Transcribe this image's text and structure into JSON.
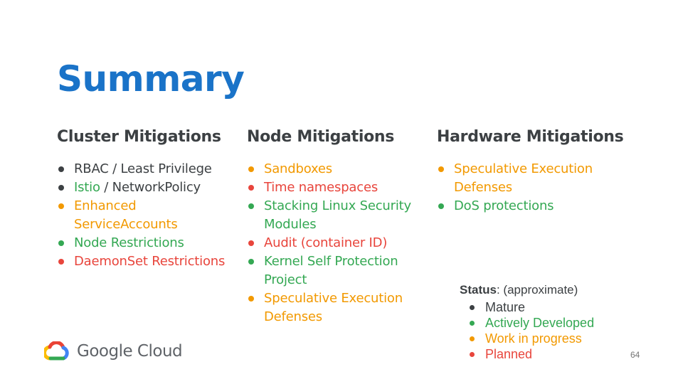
{
  "title": "Summary",
  "colors": {
    "title": "#1a73c8",
    "mature": "#3c4043",
    "active": "#34a853",
    "wip": "#f29900",
    "planned": "#e8453c"
  },
  "columns": [
    {
      "heading": "Cluster Mitigations",
      "items": [
        {
          "segments": [
            {
              "text": "RBAC / Least Privilege",
              "status": "mature"
            }
          ],
          "bullet": "mature"
        },
        {
          "segments": [
            {
              "text": "Istio",
              "status": "active"
            },
            {
              "text": " / NetworkPolicy",
              "status": "mature"
            }
          ],
          "bullet": "mature"
        },
        {
          "segments": [
            {
              "text": "Enhanced ServiceAccounts",
              "status": "wip"
            }
          ],
          "bullet": "wip"
        },
        {
          "segments": [
            {
              "text": "Node Restrictions",
              "status": "active"
            }
          ],
          "bullet": "active"
        },
        {
          "segments": [
            {
              "text": "DaemonSet Restrictions",
              "status": "planned"
            }
          ],
          "bullet": "planned"
        }
      ]
    },
    {
      "heading": "Node Mitigations",
      "items": [
        {
          "segments": [
            {
              "text": "Sandboxes",
              "status": "wip"
            }
          ],
          "bullet": "wip"
        },
        {
          "segments": [
            {
              "text": "Time namespaces",
              "status": "planned"
            }
          ],
          "bullet": "planned"
        },
        {
          "segments": [
            {
              "text": "Stacking Linux Security Modules",
              "status": "active"
            }
          ],
          "bullet": "active"
        },
        {
          "segments": [
            {
              "text": "Audit (container ID)",
              "status": "planned"
            }
          ],
          "bullet": "planned"
        },
        {
          "segments": [
            {
              "text": "Kernel Self Protection Project",
              "status": "active"
            }
          ],
          "bullet": "active"
        },
        {
          "segments": [
            {
              "text": "Speculative Execution Defenses",
              "status": "wip"
            }
          ],
          "bullet": "wip"
        }
      ]
    },
    {
      "heading": "Hardware Mitigations",
      "items": [
        {
          "segments": [
            {
              "text": "Speculative Execution Defenses",
              "status": "wip"
            }
          ],
          "bullet": "wip"
        },
        {
          "segments": [
            {
              "text": "DoS protections",
              "status": "active"
            }
          ],
          "bullet": "active"
        }
      ]
    }
  ],
  "status_legend": {
    "label_bold": "Status",
    "label_rest": ": (approximate)",
    "items": [
      {
        "text": "Mature",
        "status": "mature"
      },
      {
        "text": "Actively Developed",
        "status": "active"
      },
      {
        "text": "Work in progress",
        "status": "wip"
      },
      {
        "text": "Planned",
        "status": "planned"
      }
    ]
  },
  "logo": {
    "text": "Google Cloud",
    "icon": "google-cloud-logo-icon"
  },
  "page_number": "64"
}
